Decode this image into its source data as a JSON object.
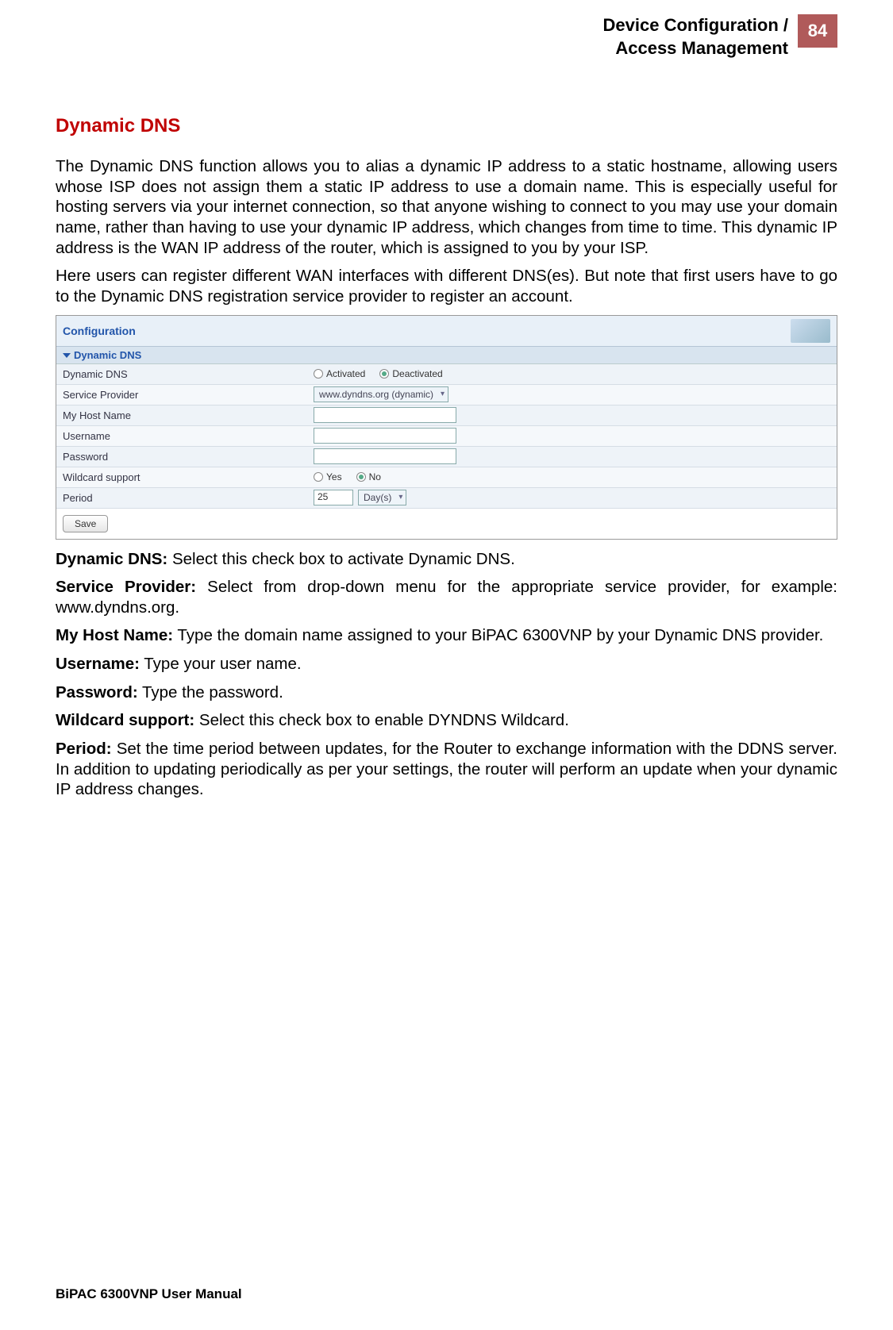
{
  "header": {
    "title_line1": "Device Configuration /",
    "title_line2": "Access Management",
    "page_number": "84"
  },
  "section_title": "Dynamic DNS",
  "para1": "The Dynamic DNS function allows you to alias a dynamic IP address to a static hostname, allowing users whose ISP does not assign them a static IP address to use a domain name. This is especially useful for hosting servers via your internet connection, so that anyone wishing to connect to you may use your domain name, rather than having to use your dynamic IP address, which changes from time to time. This dynamic IP address is the WAN IP address of the router, which is assigned to you by your ISP.",
  "para2": "Here users can register different WAN interfaces with different DNS(es). But note that first users have to go to the Dynamic DNS registration service provider to register an account.",
  "config": {
    "panel_title": "Configuration",
    "accordion": "Dynamic DNS",
    "rows": {
      "dynamic_dns_label": "Dynamic DNS",
      "activated": "Activated",
      "deactivated": "Deactivated",
      "service_provider_label": "Service Provider",
      "service_provider_value": "www.dyndns.org (dynamic)",
      "my_host_name_label": "My Host Name",
      "my_host_name_value": "",
      "username_label": "Username",
      "username_value": "",
      "password_label": "Password",
      "password_value": "",
      "wildcard_label": "Wildcard support",
      "wildcard_yes": "Yes",
      "wildcard_no": "No",
      "period_label": "Period",
      "period_value": "25",
      "period_unit": "Day(s)"
    },
    "save_button": "Save"
  },
  "defs": {
    "d1_label": "Dynamic DNS:",
    "d1_text": " Select this check box to activate Dynamic DNS.",
    "d2_label": "Service Provider:",
    "d2_text": " Select from drop-down menu for the appropriate service provider, for example: www.dyndns.org.",
    "d3_label": "My Host Name:",
    "d3_text": " Type the domain name assigned to your BiPAC 6300VNP by your Dynamic DNS provider.",
    "d4_label": "Username:",
    "d4_text": " Type your user name.",
    "d5_label": "Password:",
    "d5_text": " Type the password.",
    "d6_label": "Wildcard support:",
    "d6_text": " Select this check box to enable DYNDNS Wildcard.",
    "d7_label": "Period:",
    "d7_text": " Set the time period between updates, for the Router to exchange information with the DDNS server. In addition to updating periodically as per your settings, the router will perform an update when your dynamic IP address changes."
  },
  "footer": "BiPAC 6300VNP User Manual"
}
